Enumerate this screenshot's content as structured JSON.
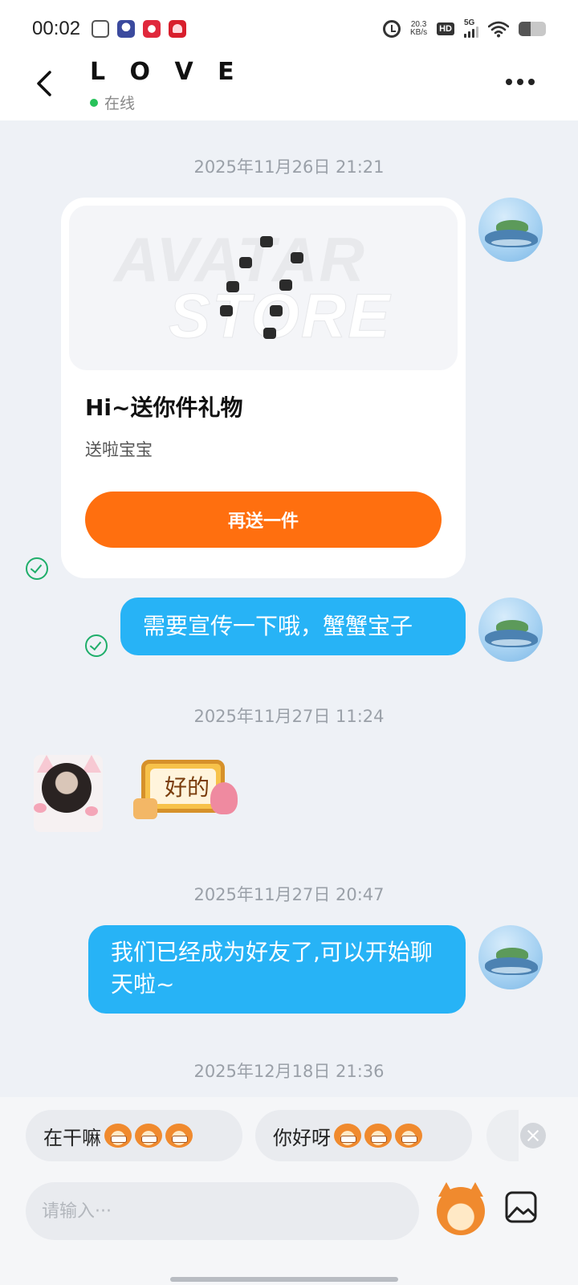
{
  "status_bar": {
    "time": "00:02",
    "net_speed_value": "20.3",
    "net_speed_unit": "KB/s",
    "hd_label": "HD",
    "network_label": "5G",
    "battery_level": 0.45,
    "app_icons": [
      "app-icon",
      "astronaut-icon",
      "clown-icon",
      "heart-icon"
    ],
    "app_icon_colors": [
      "#555555",
      "#3b4a9e",
      "#e0283c",
      "#d81e2c"
    ]
  },
  "header": {
    "title": "L O V E",
    "status": "在线",
    "status_color": "#27c25a",
    "back_icon": "chevron-left-icon",
    "more_icon": "more-dots-icon"
  },
  "messages": {
    "timestamps": [
      "2025年11月26日 21:21",
      "2025年11月27日 11:24",
      "2025年11月27日 20:47",
      "2025年12月18日 21:36"
    ],
    "gift_card": {
      "watermark_top": "AVATAR",
      "watermark_bottom": "STORE",
      "title": "Hi~送你件礼物",
      "subtitle": "送啦宝宝",
      "button": "再送一件",
      "button_color": "#ff6f0f"
    },
    "bubble_1": "需要宣传一下哦，蟹蟹宝子",
    "sticker_text": "好的",
    "bubble_2": "我们已经成为好友了,可以开始聊天啦~",
    "bubble_color": "#27b3f6",
    "read_color": "#1fae6a"
  },
  "quick_replies": {
    "chip_1": "在干嘛",
    "chip_2": "你好呀"
  },
  "composer": {
    "placeholder": "请输入···",
    "emoji_icon": "mascot-emoji-icon",
    "image_icon": "image-icon"
  }
}
